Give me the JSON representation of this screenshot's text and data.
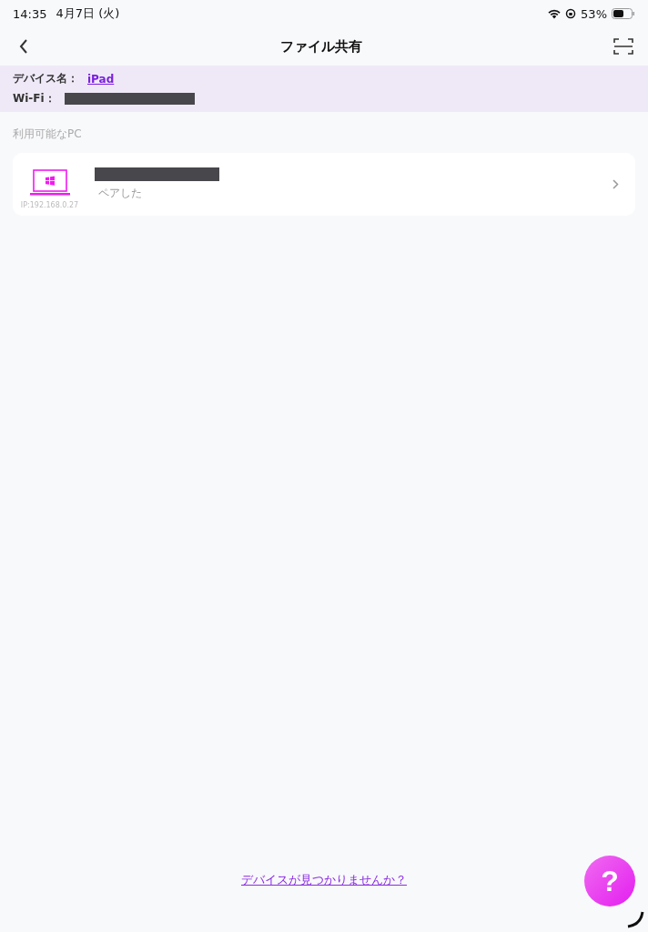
{
  "status_bar": {
    "time": "14:35",
    "date": "4月7日 (火)",
    "battery": "53%"
  },
  "nav": {
    "title": "ファイル共有"
  },
  "info": {
    "device_label": "デバイス名：",
    "device_name": "iPad",
    "wifi_label": "Wi-Fi："
  },
  "section": {
    "title": "利用可能なPC"
  },
  "pcs": [
    {
      "status": "ペアした",
      "ip": "IP:192.168.0.27"
    }
  ],
  "help_link": "デバイスが見つかりませんか？",
  "help_button": "?"
}
